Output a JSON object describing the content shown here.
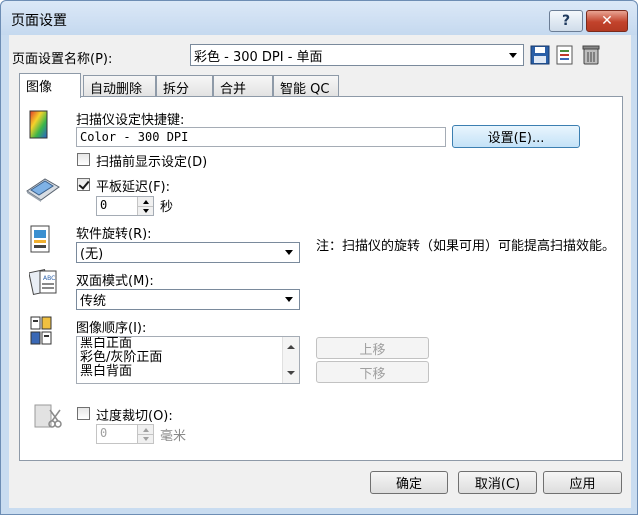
{
  "window": {
    "title": "页面设置",
    "help_label": "?",
    "close_label": "✕"
  },
  "profile": {
    "label": "页面设置名称(P):",
    "value": "彩色 - 300 DPI - 单面"
  },
  "tabs": [
    {
      "label": "图像"
    },
    {
      "label": "自动删除"
    },
    {
      "label": "拆分"
    },
    {
      "label": "合并"
    },
    {
      "label": "智能 QC"
    }
  ],
  "image_tab": {
    "shortcut_label": "扫描仪设定快捷键:",
    "shortcut_value": "Color - 300 DPI",
    "settings_button": "设置(E)...",
    "show_settings_label": "扫描前显示设定(D)",
    "show_settings_checked": false,
    "flatbed_delay_label": "平板延迟(F):",
    "flatbed_delay_checked": true,
    "flatbed_delay_value": "0",
    "flatbed_delay_unit": "秒",
    "rotation_label": "软件旋转(R):",
    "rotation_value": "(无)",
    "rotation_note": "注：扫描仪的旋转（如果可用）可能提高扫描效能。",
    "duplex_label": "双面模式(M):",
    "duplex_value": "传统",
    "order_label": "图像顺序(I):",
    "order_items": [
      "黑白正面",
      "彩色/灰阶正面",
      "黑白背面"
    ],
    "move_up_button": "上移",
    "move_down_button": "下移",
    "overscan_label": "过度裁切(O):",
    "overscan_checked": false,
    "overscan_value": "0",
    "overscan_unit": "毫米"
  },
  "footer": {
    "ok": "确定",
    "cancel": "取消(C)",
    "apply": "应用"
  },
  "colors": {
    "frame": "#c9dcf0",
    "close_red": "#c2432c",
    "default_button": "#c4e2f7"
  }
}
